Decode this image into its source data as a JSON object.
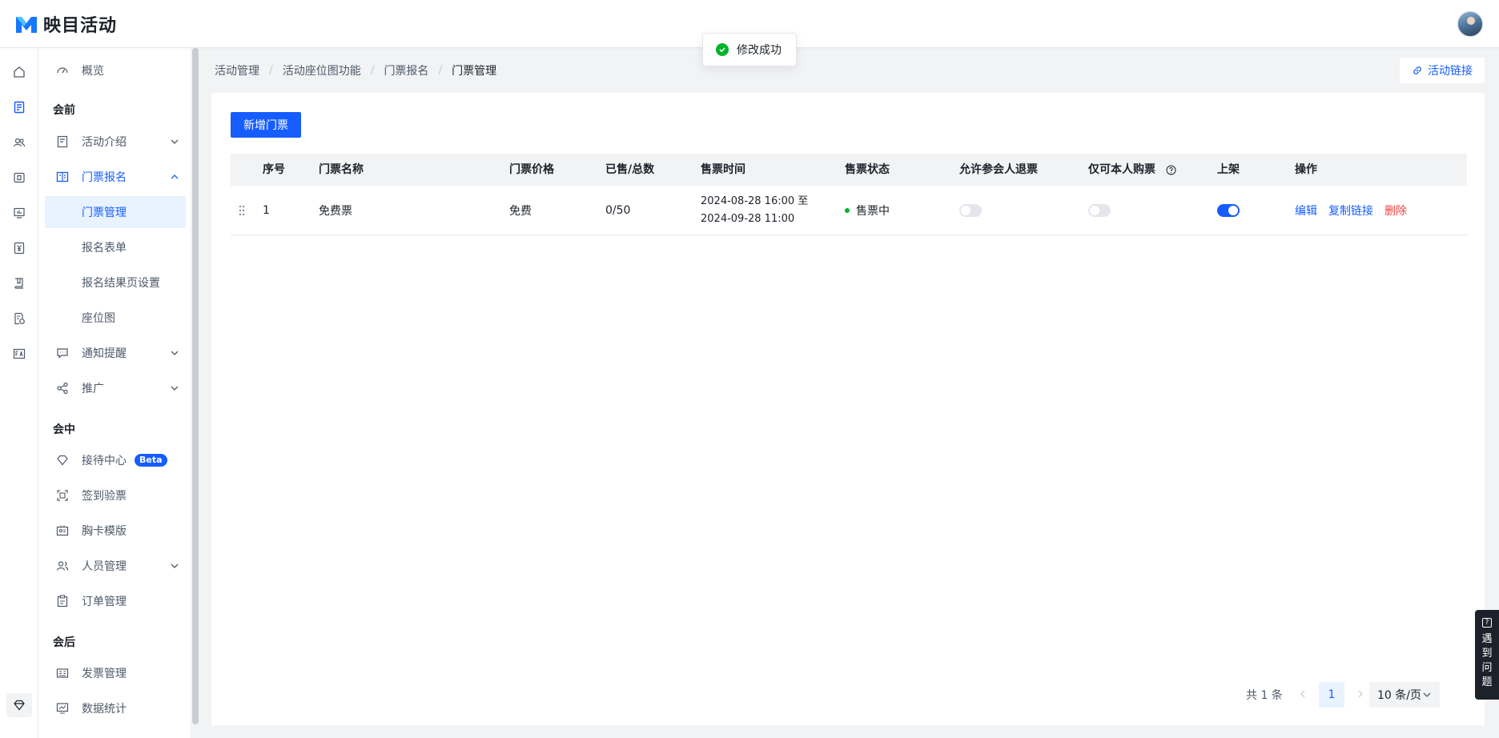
{
  "app": {
    "name": "映目活动"
  },
  "toast": {
    "message": "修改成功"
  },
  "rail": {
    "icons": [
      "home-icon",
      "ticket-list-icon",
      "people-icon",
      "media-icon",
      "screen-icon",
      "yen-icon",
      "book-icon",
      "report-icon",
      "language-icon"
    ],
    "bottom_icon": "diamond-icon"
  },
  "sidebar": {
    "overview": "概览",
    "group_before": "会前",
    "activity_intro": "活动介绍",
    "ticket_signup": "门票报名",
    "sub": {
      "ticket_manage": "门票管理",
      "signup_form": "报名表单",
      "result_page": "报名结果页设置",
      "seat_map": "座位图"
    },
    "notify": "通知提醒",
    "promote": "推广",
    "group_during": "会中",
    "reception": "接待中心",
    "beta": "Beta",
    "checkin": "签到验票",
    "badge": "胸卡模版",
    "people": "人员管理",
    "orders": "订单管理",
    "group_after": "会后",
    "invoice": "发票管理",
    "stats": "数据统计"
  },
  "breadcrumb": {
    "items": [
      "活动管理",
      "活动座位图功能",
      "门票报名"
    ],
    "current": "门票管理",
    "separator": "/"
  },
  "header": {
    "activity_link": "活动链接"
  },
  "main": {
    "add_ticket": "新增门票",
    "columns": {
      "index": "序号",
      "name": "门票名称",
      "price": "门票价格",
      "sold": "已售/总数",
      "sale_time": "售票时间",
      "status": "售票状态",
      "refund": "允许参会人退票",
      "self_only": "仅可本人购票",
      "listed": "上架",
      "actions": "操作"
    },
    "rows": [
      {
        "index": "1",
        "name": "免费票",
        "price": "免费",
        "sold": "0/50",
        "sale_start": "2024-08-28 16:00 至",
        "sale_end": "2024-09-28 11:00",
        "status": "售票中",
        "refund": false,
        "self_only": false,
        "listed": true,
        "edit": "编辑",
        "copy_link": "复制链接",
        "delete": "删除"
      }
    ]
  },
  "pagination": {
    "total": "共 1 条",
    "current": "1",
    "page_size": "10 条/页"
  },
  "help": {
    "label": [
      "遇",
      "到",
      "问",
      "题"
    ]
  },
  "colors": {
    "primary": "#165dff",
    "success": "#00b42a",
    "danger": "#f53f3f"
  }
}
